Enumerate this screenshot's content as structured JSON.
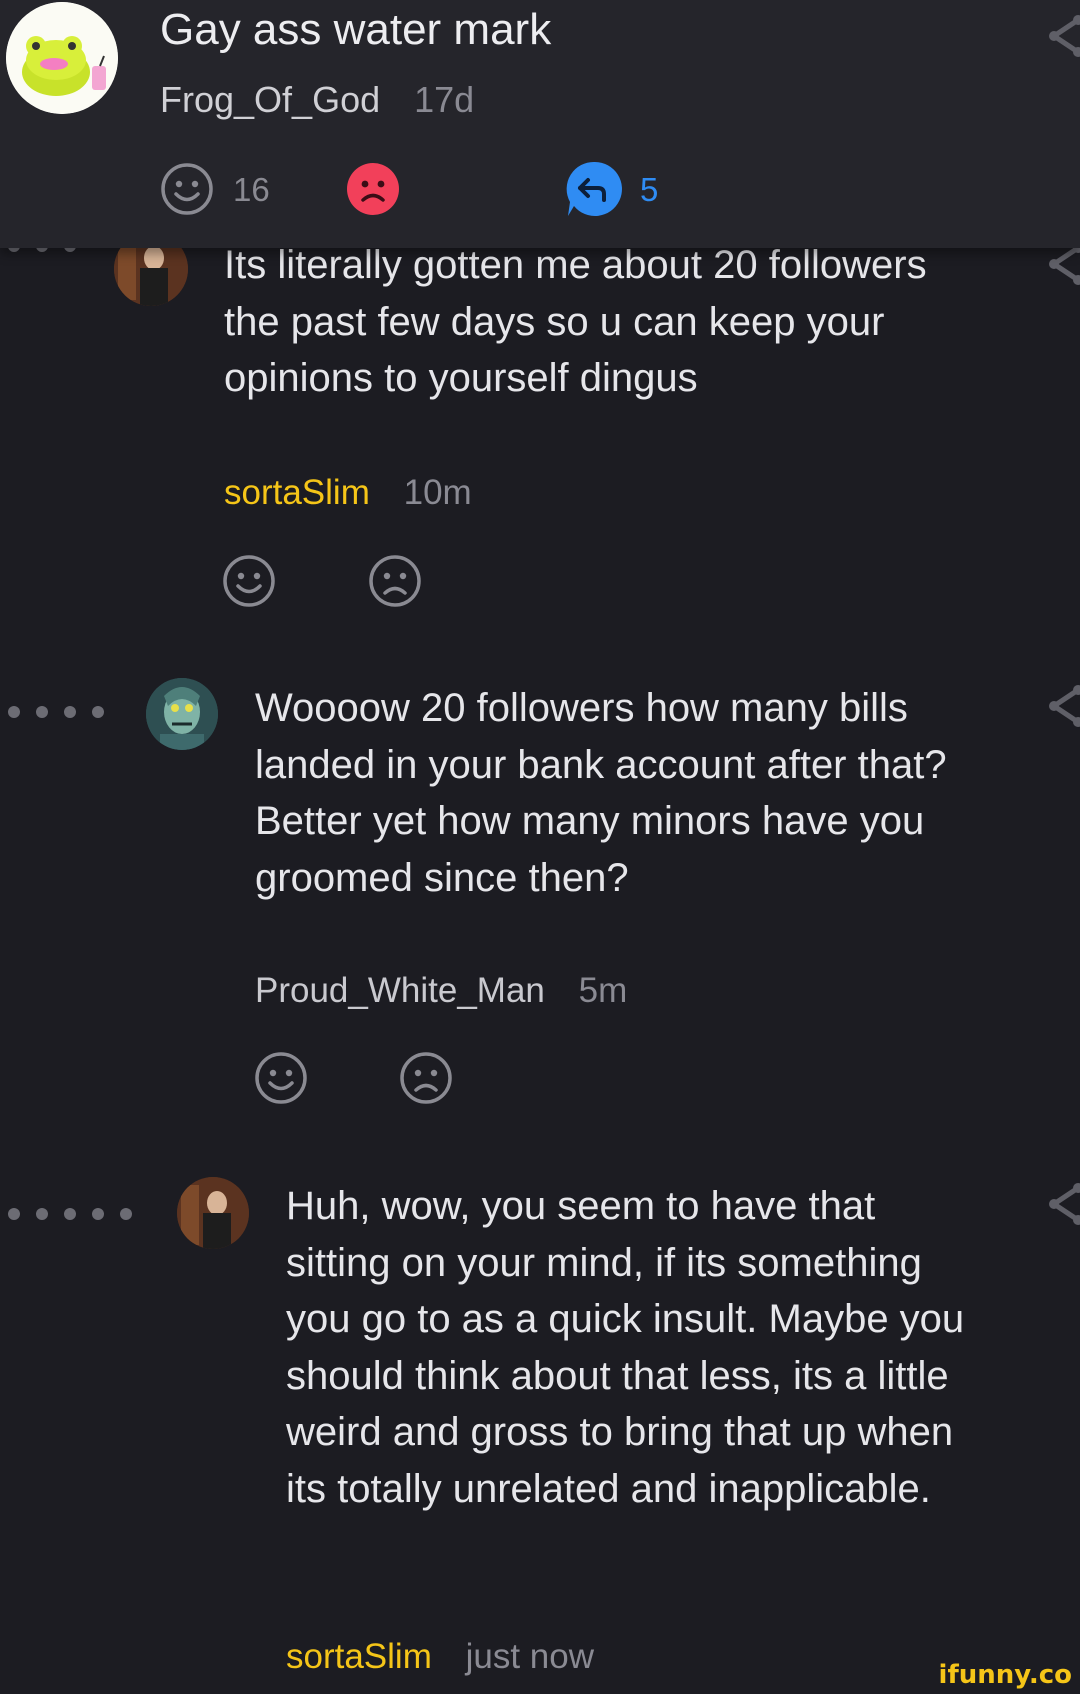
{
  "post": {
    "title": "Gay ass water mark",
    "author": "Frog_Of_God",
    "age": "17d",
    "smile_count": "16",
    "reply_count": "5"
  },
  "comments": [
    {
      "text": "Its literally gotten me about 20 followers the past few days so u can keep your opinions to yourself dingus",
      "author": "sortaSlim",
      "age": "10m"
    },
    {
      "text": "Woooow 20 followers how many bills landed in your bank account after that? Better yet how many minors have you groomed since then?",
      "author": "Proud_White_Man",
      "age": "5m"
    },
    {
      "text": "Huh, wow, you seem to have that sitting on your mind, if its something you go to as a quick insult. Maybe you should think about that less, its a little weird and gross to bring that up when its totally unrelated and inapplicable.",
      "author": "sortaSlim",
      "age": "just now"
    }
  ],
  "watermark": "ifunny.co",
  "colors": {
    "background": "#1c1c22",
    "card": "#25252b",
    "author_highlight": "#f5c518",
    "unsmile_active": "#f2405a",
    "reply_blue": "#2f8cf3"
  },
  "icons": [
    "frog-avatar-icon",
    "smile-icon",
    "unsmile-icon",
    "reply-icon",
    "share-icon",
    "thread-dots-icon"
  ]
}
